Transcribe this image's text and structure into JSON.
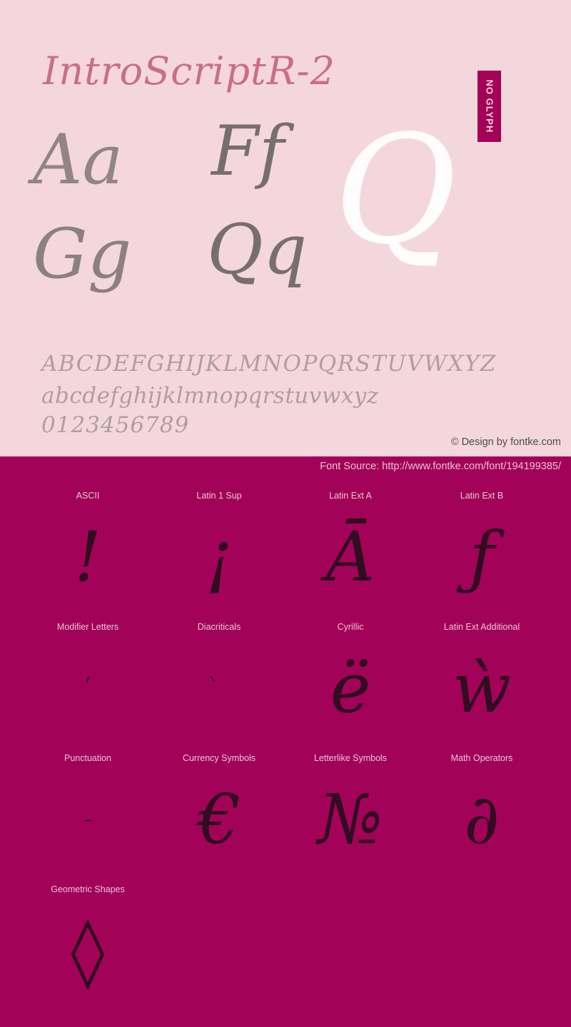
{
  "specimen": {
    "font_title": "IntroScriptR-2",
    "badge_label": "NO GLYPH",
    "big_samples": [
      {
        "name": "sample-aa",
        "text": "Aa"
      },
      {
        "name": "sample-ff",
        "text": "Ff"
      },
      {
        "name": "sample-q-large",
        "text": "Q"
      },
      {
        "name": "sample-gg",
        "text": "Gg"
      },
      {
        "name": "sample-qq",
        "text": "Qq"
      }
    ],
    "alphabet_upper": "ABCDEFGHIJKLMNOPQRSTUVWXYZ",
    "alphabet_lower": "abcdefghijklmnopqrstuvwxyz",
    "digits": "0123456789",
    "copyright": "© Design by fontke.com"
  },
  "blocks_panel": {
    "font_source": "Font Source: http://www.fontke.com/font/194199385/",
    "rows": [
      [
        {
          "label": "ASCII",
          "sample": "!",
          "size": "normal"
        },
        {
          "label": "Latin 1 Sup",
          "sample": "¡",
          "size": "normal"
        },
        {
          "label": "Latin Ext A",
          "sample": "Ā",
          "size": "normal"
        },
        {
          "label": "Latin Ext B",
          "sample": "ƒ",
          "size": "normal"
        }
      ],
      [
        {
          "label": "Modifier Letters",
          "sample": "ʹ",
          "size": "tiny"
        },
        {
          "label": "Diacriticals",
          "sample": "̀",
          "size": "tiny"
        },
        {
          "label": "Cyrillic",
          "sample": "ё",
          "size": "normal"
        },
        {
          "label": "Latin Ext Additional",
          "sample": "ẁ",
          "size": "normal"
        }
      ],
      [
        {
          "label": "Punctuation",
          "sample": "‐",
          "size": "tiny"
        },
        {
          "label": "Currency Symbols",
          "sample": "€",
          "size": "normal"
        },
        {
          "label": "Letterlike Symbols",
          "sample": "№",
          "size": "normal"
        },
        {
          "label": "Math Operators",
          "sample": "∂",
          "size": "normal"
        }
      ],
      [
        {
          "label": "Geometric Shapes",
          "sample": "◊",
          "size": "normal"
        }
      ]
    ]
  },
  "colors": {
    "panel_background": "#f4d7dc",
    "accent_magenta": "#a30259",
    "title_text": "#b9456f",
    "label_text": "#e7c7d6"
  }
}
